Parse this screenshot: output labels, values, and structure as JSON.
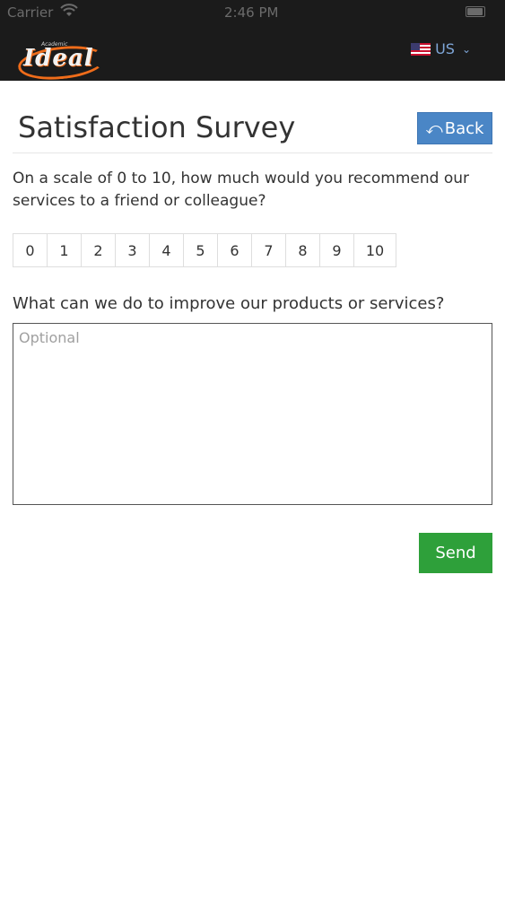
{
  "status_bar": {
    "carrier": "Carrier",
    "time": "2:46 PM"
  },
  "header": {
    "logo_text": "Ideal",
    "logo_tagline": "Academic",
    "language": "US",
    "colors": {
      "bar": "#1b1b1b",
      "logo_accent": "#ef6c1a",
      "language": "#7fa7d9"
    }
  },
  "page": {
    "title": "Satisfaction Survey",
    "back_label": "Back"
  },
  "survey": {
    "question_1": "On a scale of 0 to 10, how much would you recommend our services to a friend or colleague?",
    "scale": [
      "0",
      "1",
      "2",
      "3",
      "4",
      "5",
      "6",
      "7",
      "8",
      "9",
      "10"
    ],
    "question_2": "What can we do to improve our products or services?",
    "feedback_placeholder": "Optional",
    "send_label": "Send"
  },
  "colors": {
    "back_button": "#4a86c6",
    "send_button": "#2ea03a"
  }
}
